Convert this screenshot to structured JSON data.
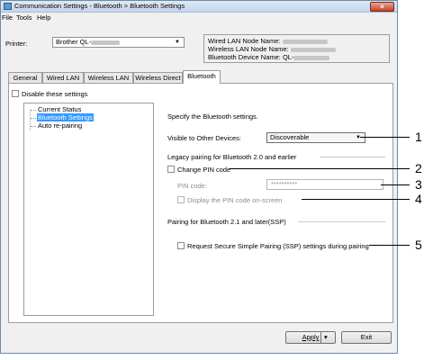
{
  "window": {
    "title": "Communication Settings - Bluetooth > Bluetooth Settings",
    "close_label": "×"
  },
  "menu": [
    "File",
    "Tools",
    "Help"
  ],
  "printer": {
    "label": "Printer:",
    "value": "Brother QL-"
  },
  "node_info": {
    "wired": "Wired LAN Node Name:",
    "wireless": "Wireless LAN Node Name:",
    "bluetooth": "Bluetooth Device Name: QL-"
  },
  "tabs": [
    "General",
    "Wired LAN",
    "Wireless LAN",
    "Wireless Direct",
    "Bluetooth"
  ],
  "disable_label": "Disable these settings",
  "tree": [
    "Current Status",
    "Bluetooth Settings",
    "Auto re-pairing"
  ],
  "content": {
    "heading": "Specify the Bluetooth settings.",
    "visible_label": "Visible to Other Devices:",
    "visible_value": "Discoverable",
    "legacy_heading": "Legacy pairing for Bluetooth 2.0 and earlier",
    "change_pin_label": "Change PIN code",
    "pin_label": "PIN code:",
    "pin_value": "**********",
    "display_pin_label": "Display the PIN code on-screen",
    "ssp_heading": "Pairing for Bluetooth 2.1 and later(SSP)",
    "ssp_label": "Request Secure Simple Pairing (SSP) settings during pairing"
  },
  "buttons": {
    "apply": "Apply",
    "apply_arrow": "▾",
    "exit": "Exit"
  },
  "callouts": [
    "1",
    "2",
    "3",
    "4",
    "5"
  ]
}
